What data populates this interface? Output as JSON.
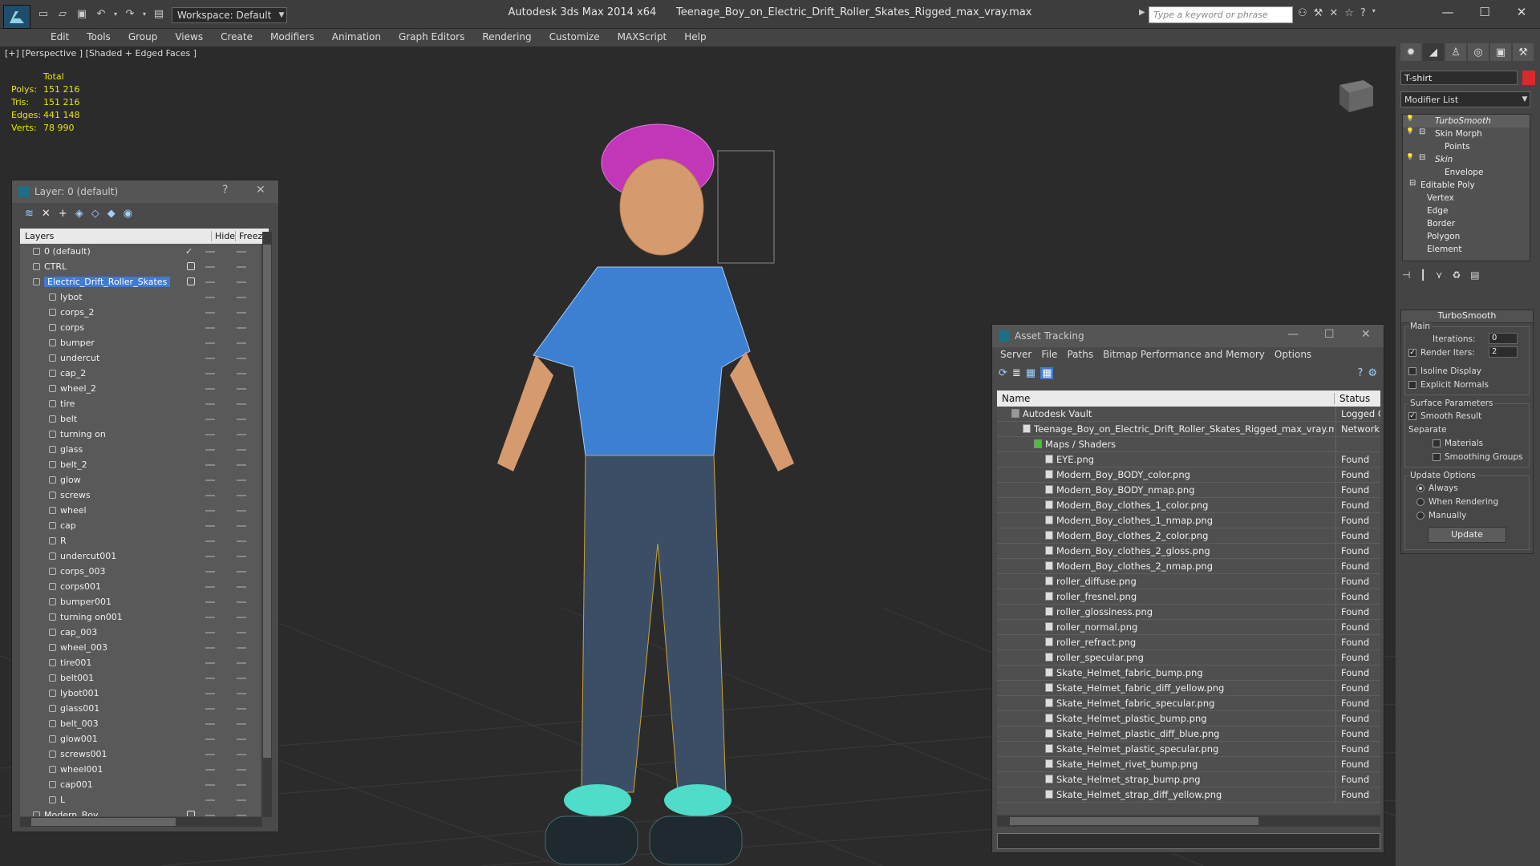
{
  "app": {
    "title": "Autodesk 3ds Max  2014 x64",
    "file": "Teenage_Boy_on_Electric_Drift_Roller_Skates_Rigged_max_vray.max",
    "workspace": "Workspace: Default",
    "search_placeholder": "Type a keyword or phrase"
  },
  "menu": [
    "Edit",
    "Tools",
    "Group",
    "Views",
    "Create",
    "Modifiers",
    "Animation",
    "Graph Editors",
    "Rendering",
    "Customize",
    "MAXScript",
    "Help"
  ],
  "viewport": {
    "label": "[+] [Perspective ] [Shaded + Edged Faces ]",
    "stats": {
      "header": "Total",
      "rows": [
        {
          "k": "Polys:",
          "v": "151 216"
        },
        {
          "k": "Tris:",
          "v": "151 216"
        },
        {
          "k": "Edges:",
          "v": "441 148"
        },
        {
          "k": "Verts:",
          "v": "78 990"
        }
      ]
    }
  },
  "layer_panel": {
    "title": "Layer: 0 (default)",
    "col_layers": "Layers",
    "col_hide": "Hide",
    "col_freeze": "Freeze",
    "rows": [
      {
        "name": "0 (default)",
        "level": 0,
        "mark": "check"
      },
      {
        "name": "CTRL",
        "level": 0,
        "mark": "box"
      },
      {
        "name": "Electric_Drift_Roller_Skates",
        "level": 0,
        "mark": "box",
        "selected": true
      },
      {
        "name": "lybot",
        "level": 1
      },
      {
        "name": "corps_2",
        "level": 1
      },
      {
        "name": "corps",
        "level": 1
      },
      {
        "name": "bumper",
        "level": 1
      },
      {
        "name": "undercut",
        "level": 1
      },
      {
        "name": "cap_2",
        "level": 1
      },
      {
        "name": "wheel_2",
        "level": 1
      },
      {
        "name": "tire",
        "level": 1
      },
      {
        "name": "belt",
        "level": 1
      },
      {
        "name": "turning on",
        "level": 1
      },
      {
        "name": "glass",
        "level": 1
      },
      {
        "name": "belt_2",
        "level": 1
      },
      {
        "name": "glow",
        "level": 1
      },
      {
        "name": "screws",
        "level": 1
      },
      {
        "name": "wheel",
        "level": 1
      },
      {
        "name": "cap",
        "level": 1
      },
      {
        "name": "R",
        "level": 1
      },
      {
        "name": "undercut001",
        "level": 1
      },
      {
        "name": "corps_003",
        "level": 1
      },
      {
        "name": "corps001",
        "level": 1
      },
      {
        "name": "bumper001",
        "level": 1
      },
      {
        "name": "turning on001",
        "level": 1
      },
      {
        "name": "cap_003",
        "level": 1
      },
      {
        "name": "wheel_003",
        "level": 1
      },
      {
        "name": "tire001",
        "level": 1
      },
      {
        "name": "belt001",
        "level": 1
      },
      {
        "name": "lybot001",
        "level": 1
      },
      {
        "name": "glass001",
        "level": 1
      },
      {
        "name": "belt_003",
        "level": 1
      },
      {
        "name": "glow001",
        "level": 1
      },
      {
        "name": "screws001",
        "level": 1
      },
      {
        "name": "wheel001",
        "level": 1
      },
      {
        "name": "cap001",
        "level": 1
      },
      {
        "name": "L",
        "level": 1
      },
      {
        "name": "Modern_Boy",
        "level": 0,
        "mark": "box"
      }
    ]
  },
  "asset_panel": {
    "title": "Asset Tracking",
    "menu": [
      "Server",
      "File",
      "Paths",
      "Bitmap Performance and Memory",
      "Options"
    ],
    "col_name": "Name",
    "col_status": "Status",
    "rows": [
      {
        "name": "Autodesk Vault",
        "status": "Logged Out",
        "level": 0
      },
      {
        "name": "Teenage_Boy_on_Electric_Drift_Roller_Skates_Rigged_max_vray.max",
        "status": "Network Path",
        "level": 1
      },
      {
        "name": "Maps / Shaders",
        "status": "",
        "level": 2
      },
      {
        "name": "EYE.png",
        "status": "Found",
        "level": 3
      },
      {
        "name": "Modern_Boy_BODY_color.png",
        "status": "Found",
        "level": 3
      },
      {
        "name": "Modern_Boy_BODY_nmap.png",
        "status": "Found",
        "level": 3
      },
      {
        "name": "Modern_Boy_clothes_1_color.png",
        "status": "Found",
        "level": 3
      },
      {
        "name": "Modern_Boy_clothes_1_nmap.png",
        "status": "Found",
        "level": 3
      },
      {
        "name": "Modern_Boy_clothes_2_color.png",
        "status": "Found",
        "level": 3
      },
      {
        "name": "Modern_Boy_clothes_2_gloss.png",
        "status": "Found",
        "level": 3
      },
      {
        "name": "Modern_Boy_clothes_2_nmap.png",
        "status": "Found",
        "level": 3
      },
      {
        "name": "roller_diffuse.png",
        "status": "Found",
        "level": 3
      },
      {
        "name": "roller_fresnel.png",
        "status": "Found",
        "level": 3
      },
      {
        "name": "roller_glossiness.png",
        "status": "Found",
        "level": 3
      },
      {
        "name": "roller_normal.png",
        "status": "Found",
        "level": 3
      },
      {
        "name": "roller_refract.png",
        "status": "Found",
        "level": 3
      },
      {
        "name": "roller_specular.png",
        "status": "Found",
        "level": 3
      },
      {
        "name": "Skate_Helmet_fabric_bump.png",
        "status": "Found",
        "level": 3
      },
      {
        "name": "Skate_Helmet_fabric_diff_yellow.png",
        "status": "Found",
        "level": 3
      },
      {
        "name": "Skate_Helmet_fabric_specular.png",
        "status": "Found",
        "level": 3
      },
      {
        "name": "Skate_Helmet_plastic_bump.png",
        "status": "Found",
        "level": 3
      },
      {
        "name": "Skate_Helmet_plastic_diff_blue.png",
        "status": "Found",
        "level": 3
      },
      {
        "name": "Skate_Helmet_plastic_specular.png",
        "status": "Found",
        "level": 3
      },
      {
        "name": "Skate_Helmet_rivet_bump.png",
        "status": "Found",
        "level": 3
      },
      {
        "name": "Skate_Helmet_strap_bump.png",
        "status": "Found",
        "level": 3
      },
      {
        "name": "Skate_Helmet_strap_diff_yellow.png",
        "status": "Found",
        "level": 3
      }
    ]
  },
  "command_panel": {
    "object_name": "T-shirt",
    "object_color": "#d82a2a",
    "modifier_list": "Modifier List",
    "stack": [
      {
        "name": "TurboSmooth",
        "level": 0,
        "italic": true
      },
      {
        "name": "Skin Morph",
        "level": 0
      },
      {
        "name": "Points",
        "level": 1
      },
      {
        "name": "Skin",
        "level": 0,
        "italic": true
      },
      {
        "name": "Envelope",
        "level": 1
      },
      {
        "name": "Editable Poly",
        "level": 0
      },
      {
        "name": "Vertex",
        "level": 1
      },
      {
        "name": "Edge",
        "level": 1
      },
      {
        "name": "Border",
        "level": 1
      },
      {
        "name": "Polygon",
        "level": 1
      },
      {
        "name": "Element",
        "level": 1
      }
    ],
    "rollout_title": "TurboSmooth",
    "main_label": "Main",
    "iterations_label": "Iterations:",
    "iterations_value": "0",
    "render_iters_label": "Render Iters:",
    "render_iters_value": "2",
    "isoline": "Isoline Display",
    "explicit": "Explicit Normals",
    "surface_label": "Surface Parameters",
    "smooth_result": "Smooth Result",
    "separate_label": "Separate",
    "materials": "Materials",
    "smoothing_groups": "Smoothing Groups",
    "update_label": "Update Options",
    "always": "Always",
    "when_rendering": "When Rendering",
    "manually": "Manually",
    "update_button": "Update"
  }
}
